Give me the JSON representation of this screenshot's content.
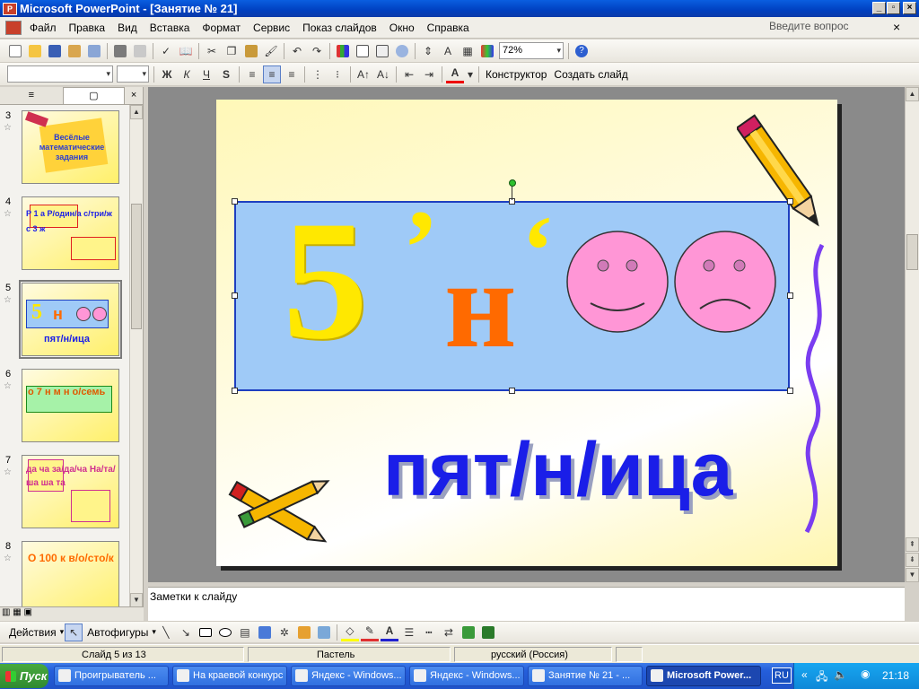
{
  "window": {
    "title": "Microsoft PowerPoint - [Занятие № 21]",
    "app_icon_text": "P"
  },
  "menu": {
    "items": [
      "Файл",
      "Правка",
      "Вид",
      "Вставка",
      "Формат",
      "Сервис",
      "Показ слайдов",
      "Окно",
      "Справка"
    ],
    "help_box": "Введите вопрос",
    "close": "×"
  },
  "toolbar_standard": {
    "zoom": "72%",
    "help": "?"
  },
  "toolbar_format": {
    "font_bold": "Ж",
    "font_italic": "К",
    "font_underline": "Ч",
    "font_shadow": "S",
    "designer": "Конструктор",
    "new_slide": "Создать слайд"
  },
  "left_pane": {
    "tab_outline": "≡",
    "tab_slides": "▢",
    "close": "×",
    "thumbs": [
      {
        "num": "3",
        "text": "Весёлые математические задания"
      },
      {
        "num": "4",
        "text": "Р 1 а  Р/один/а  с/три/ж  с 3 ж"
      },
      {
        "num": "5",
        "text": "пят/н/ица"
      },
      {
        "num": "6",
        "text": "о 7 н м  н  о/семь"
      },
      {
        "num": "7",
        "text": "да ча за/да/ча На/та/ша ша та"
      },
      {
        "num": "8",
        "text": "О 100 к в/о/сто/к"
      }
    ]
  },
  "slide": {
    "big_five": "5",
    "apostrophe1": "’",
    "letter": "н",
    "apostrophe2": "‘",
    "word": "пят/н/ица"
  },
  "notes": {
    "placeholder": "Заметки к слайду"
  },
  "drawing": {
    "actions": "Действия",
    "autoshapes": "Автофигуры"
  },
  "status": {
    "slide": "Слайд 5 из 13",
    "design": "Пастель",
    "language": "русский (Россия)"
  },
  "taskbar": {
    "start": "Пуск",
    "buttons": [
      "Проигрыватель ...",
      "На краевой конкурс",
      "Яндекс - Windows...",
      "Яндекс - Windows...",
      "Занятие № 21 - ...",
      "Microsoft Power..."
    ],
    "lang": "RU",
    "time": "21:18"
  },
  "colors": {
    "title_bar": "#0a5ee0",
    "slide_box": "#9fcaf7",
    "digit": "#ffe800",
    "letter": "#ff6a00",
    "word": "#1a1ee8",
    "smiley": "#ff96d6"
  }
}
